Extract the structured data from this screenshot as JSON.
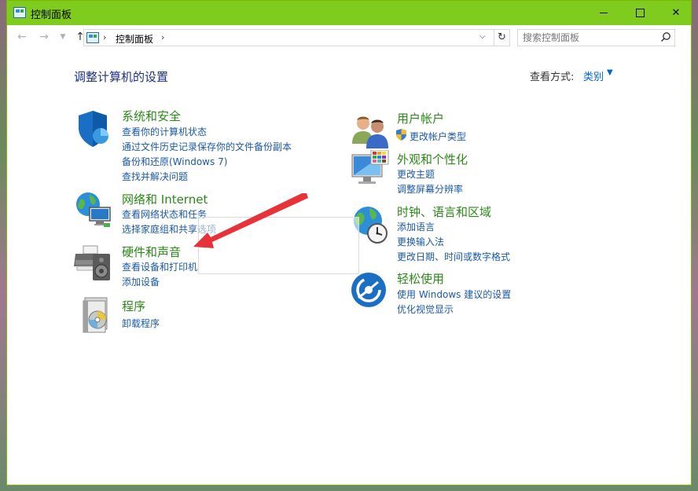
{
  "window": {
    "title": "控制面板",
    "minimize_icon": "minimize-icon",
    "maximize_icon": "maximize-icon",
    "close_icon": "close-icon"
  },
  "nav": {
    "breadcrumb": "控制面板",
    "search_placeholder": "搜索控制面板"
  },
  "main": {
    "heading": "调整计算机的设置",
    "view_by_label": "查看方式:",
    "view_by_value": "类别"
  },
  "categories": {
    "system": {
      "title": "系统和安全",
      "links": [
        "查看你的计算机状态",
        "通过文件历史记录保存你的文件备份副本",
        "备份和还原(Windows 7)",
        "查找并解决问题"
      ],
      "icon": "shield-icon"
    },
    "network": {
      "title": "网络和 Internet",
      "links": [
        "查看网络状态和任务",
        "选择家庭组和共享选项"
      ],
      "icon": "network-globe-icon"
    },
    "hardware": {
      "title": "硬件和声音",
      "links": [
        "查看设备和打印机",
        "添加设备"
      ],
      "icon": "printer-speaker-icon"
    },
    "programs": {
      "title": "程序",
      "links": [
        "卸载程序"
      ],
      "icon": "programs-disc-icon"
    },
    "user": {
      "title": "用户帐户",
      "links": [
        "更改帐户类型"
      ],
      "icon": "users-icon"
    },
    "appearance": {
      "title": "外观和个性化",
      "links": [
        "更改主题",
        "调整屏幕分辨率"
      ],
      "icon": "monitor-palette-icon"
    },
    "clock": {
      "title": "时钟、语言和区域",
      "links": [
        "添加语言",
        "更换输入法",
        "更改日期、时间或数字格式"
      ],
      "icon": "clock-globe-icon"
    },
    "ease": {
      "title": "轻松使用",
      "links": [
        "使用 Windows 建议的设置",
        "优化视觉显示"
      ],
      "icon": "ease-of-access-icon"
    }
  },
  "colors": {
    "titlebar": "#7fcc1e",
    "category_title": "#2a8a16",
    "link": "#1a5aa8",
    "heading": "#1e3287",
    "annotation_arrow": "#e8323a"
  }
}
